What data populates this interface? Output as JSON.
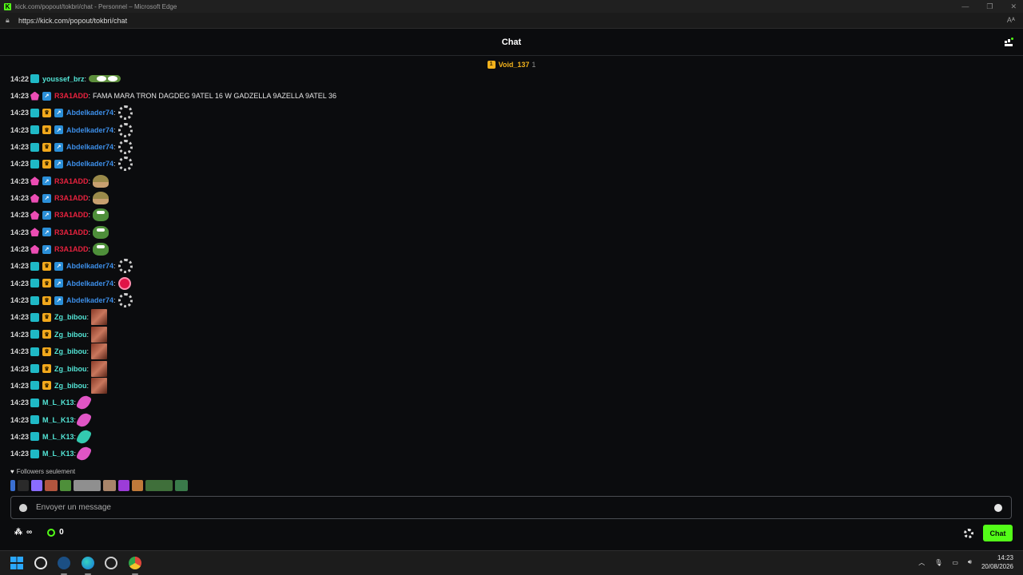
{
  "window": {
    "title": "kick.com/popout/tokbri/chat - Personnel – Microsoft Edge",
    "url": "https://kick.com/popout/tokbri/chat",
    "reader_label": "Aᴬ"
  },
  "chat": {
    "title": "Chat",
    "pinned_user": "Void_137",
    "pinned_count": "1",
    "colors": {
      "accent": "#53fc18",
      "blue": "#3c8ee8",
      "red": "#e8223e",
      "teal": "#53e5d6",
      "gold": "#f2b21c"
    }
  },
  "messages": [
    {
      "time": "14:22",
      "badges": [
        "sub"
      ],
      "user": "youssef_brz",
      "color": "#53e5d6",
      "emote": "eyes"
    },
    {
      "time": "14:23",
      "badges": [
        "pink",
        "verif"
      ],
      "user": "R3A1ADD",
      "color": "#e8223e",
      "text": "FAMA MARA TRON DAGDEG 9ATEL 16 W GADZELLA 9AZELLA 9ATEL 36"
    },
    {
      "time": "14:23",
      "badges": [
        "sub",
        "crown",
        "verif"
      ],
      "user": "Abdelkader74",
      "color": "#3c8ee8",
      "emote": "spinner"
    },
    {
      "time": "14:23",
      "badges": [
        "sub",
        "crown",
        "verif"
      ],
      "user": "Abdelkader74",
      "color": "#3c8ee8",
      "emote": "spinner"
    },
    {
      "time": "14:23",
      "badges": [
        "sub",
        "crown",
        "verif"
      ],
      "user": "Abdelkader74",
      "color": "#3c8ee8",
      "emote": "spinner"
    },
    {
      "time": "14:23",
      "badges": [
        "sub",
        "crown",
        "verif"
      ],
      "user": "Abdelkader74",
      "color": "#3c8ee8",
      "emote": "spinner"
    },
    {
      "time": "14:23",
      "badges": [
        "pink",
        "verif"
      ],
      "user": "R3A1ADD",
      "color": "#e8223e",
      "emote": "helmet"
    },
    {
      "time": "14:23",
      "badges": [
        "pink",
        "verif"
      ],
      "user": "R3A1ADD",
      "color": "#e8223e",
      "emote": "helmet"
    },
    {
      "time": "14:23",
      "badges": [
        "pink",
        "verif"
      ],
      "user": "R3A1ADD",
      "color": "#e8223e",
      "emote": "pepe"
    },
    {
      "time": "14:23",
      "badges": [
        "pink",
        "verif"
      ],
      "user": "R3A1ADD",
      "color": "#e8223e",
      "emote": "pepe"
    },
    {
      "time": "14:23",
      "badges": [
        "pink",
        "verif"
      ],
      "user": "R3A1ADD",
      "color": "#e8223e",
      "emote": "pepe"
    },
    {
      "time": "14:23",
      "badges": [
        "sub",
        "crown",
        "verif"
      ],
      "user": "Abdelkader74",
      "color": "#3c8ee8",
      "emote": "spinner"
    },
    {
      "time": "14:23",
      "badges": [
        "sub",
        "crown",
        "verif"
      ],
      "user": "Abdelkader74",
      "color": "#3c8ee8",
      "emote": "redball"
    },
    {
      "time": "14:23",
      "badges": [
        "sub",
        "crown",
        "verif"
      ],
      "user": "Abdelkader74",
      "color": "#3c8ee8",
      "emote": "spinner"
    },
    {
      "time": "14:23",
      "badges": [
        "sub",
        "crown"
      ],
      "user": "Zg_bibou",
      "color": "#53e5d6",
      "emote": "pic"
    },
    {
      "time": "14:23",
      "badges": [
        "sub",
        "crown"
      ],
      "user": "Zg_bibou",
      "color": "#53e5d6",
      "emote": "pic"
    },
    {
      "time": "14:23",
      "badges": [
        "sub",
        "crown"
      ],
      "user": "Zg_bibou",
      "color": "#53e5d6",
      "emote": "pic"
    },
    {
      "time": "14:23",
      "badges": [
        "sub",
        "crown"
      ],
      "user": "Zg_bibou",
      "color": "#53e5d6",
      "emote": "pic"
    },
    {
      "time": "14:23",
      "badges": [
        "sub",
        "crown"
      ],
      "user": "Zg_bibou",
      "color": "#53e5d6",
      "emote": "pic"
    },
    {
      "time": "14:23",
      "badges": [
        "sub"
      ],
      "user": "M_L_K13",
      "color": "#53e5d6",
      "emote": "feather"
    },
    {
      "time": "14:23",
      "badges": [
        "sub"
      ],
      "user": "M_L_K13",
      "color": "#53e5d6",
      "emote": "feather"
    },
    {
      "time": "14:23",
      "badges": [
        "sub"
      ],
      "user": "M_L_K13",
      "color": "#53e5d6",
      "emote": "feather-teal"
    },
    {
      "time": "14:23",
      "badges": [
        "sub"
      ],
      "user": "M_L_K13",
      "color": "#53e5d6",
      "emote": "feather"
    }
  ],
  "footer": {
    "followers_label": "Followers seulement",
    "input_placeholder": "Envoyer un message",
    "infinity": "∞",
    "points": "0",
    "chat_button": "Chat"
  },
  "taskbar": {
    "time": "14:23",
    "date": "20/08/2026"
  }
}
